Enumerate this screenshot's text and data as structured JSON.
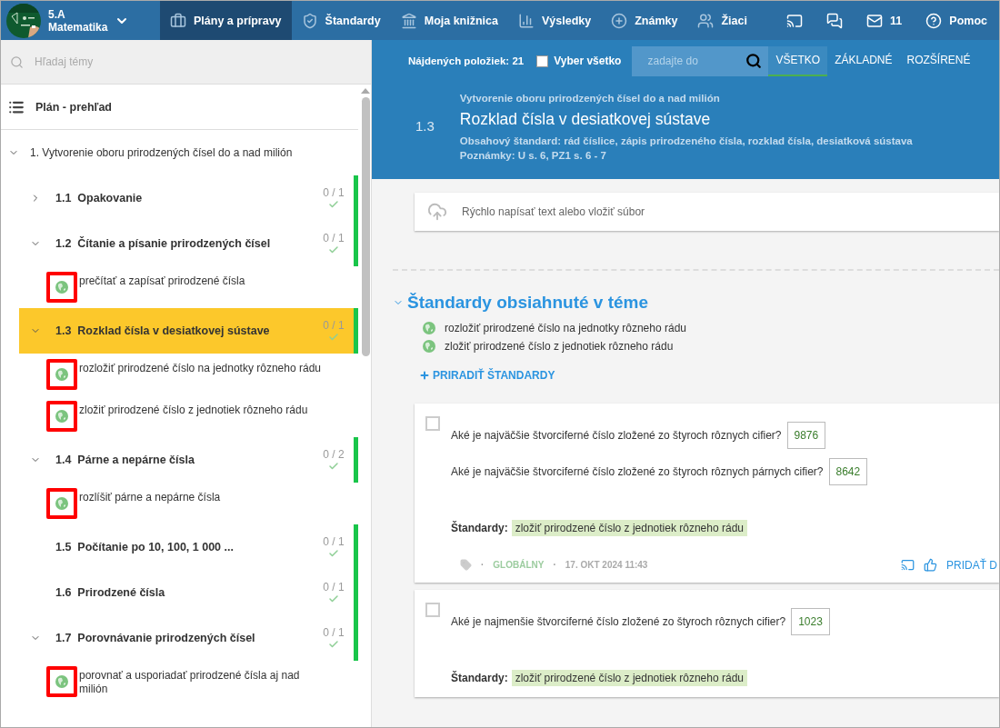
{
  "class_menu": {
    "class": "5.A",
    "subject": "Matematika"
  },
  "nav": [
    {
      "kind": "briefcase",
      "label": "Plány a prípravy",
      "selected": true
    },
    {
      "kind": "shield",
      "label": "Štandardy",
      "selected": false
    },
    {
      "kind": "bank",
      "label": "Moja knižnica",
      "selected": false
    },
    {
      "kind": "chart",
      "label": "Výsledky",
      "selected": false
    },
    {
      "kind": "grade",
      "label": "Známky",
      "selected": false
    },
    {
      "kind": "people",
      "label": "Žiaci",
      "selected": false
    }
  ],
  "toolbar_right": [
    {
      "kind": "cast"
    },
    {
      "kind": "chat"
    },
    {
      "kind": "mail",
      "label": "11"
    },
    {
      "kind": "help",
      "label": "Pomoc"
    }
  ],
  "sidebar": {
    "search": {
      "placeholder": "Hľadaj témy"
    },
    "overview": "Plán - prehľad",
    "sections": [
      {
        "title": "1. Vytvorenie oboru prirodzených čísel do a nad milión",
        "expanded": true,
        "children": [
          {
            "number": "1.1",
            "title": "Opakovanie",
            "count": "0 / 1",
            "expanded": false,
            "selected": false
          },
          {
            "number": "1.2",
            "title": "Čítanie a písanie prirodzených čísel",
            "count": "0 / 1",
            "expanded": true,
            "selected": false,
            "children": [
              {
                "text": "prečítať a zapísať prirodzené čísla",
                "marked": true
              }
            ]
          },
          {
            "number": "1.3",
            "title": "Rozklad čísla v desiatkovej sústave",
            "count": "0 / 1",
            "expanded": true,
            "selected": true,
            "children": [
              {
                "text": "rozložiť prirodzené číslo na jednotky rôzneho rádu",
                "marked": true
              },
              {
                "text": "zložiť prirodzené číslo z jednotiek rôzneho rádu",
                "marked": true
              }
            ]
          },
          {
            "number": "1.4",
            "title": "Párne a nepárne čísla",
            "count": "0 / 2",
            "expanded": true,
            "selected": false,
            "children": [
              {
                "text": "rozlíšiť párne a nepárne čísla",
                "marked": true
              }
            ]
          },
          {
            "number": "1.5",
            "title": "Počítanie po 10, 100, 1 000 ...",
            "count": "0 / 1",
            "selected": false
          },
          {
            "number": "1.6",
            "title": "Prirodzené čísla",
            "count": "0 / 1",
            "selected": false
          },
          {
            "number": "1.7",
            "title": "Porovnávanie prirodzených čísel",
            "count": "0 / 1",
            "expanded": true,
            "selected": false,
            "children": [
              {
                "text": "porovnať a usporiadať prirodzené čísla aj nad milión",
                "marked": true
              }
            ]
          }
        ]
      }
    ]
  },
  "filter_bar": {
    "found": "Nájdených položiek: 21",
    "select_all": {
      "label": "Vyber všetko",
      "checked": false
    },
    "search": {
      "placeholder": "zadajte do"
    },
    "tabs": [
      {
        "label": "VŠETKO",
        "selected": true
      },
      {
        "label": "ZÁKLADNÉ",
        "selected": false
      },
      {
        "label": "ROZŠÍRENÉ",
        "selected": false
      }
    ]
  },
  "topic_header": {
    "breadcrumb": "Vytvorenie oboru prirodzených čísel do a nad milión",
    "number": "1.3",
    "title": "Rozklad čísla v desiatkovej sústave",
    "standard_line": "Obsahový štandard: rád číslice, zápis prirodzeného čísla, rozklad čísla, desiatková sústava",
    "notes": "Poznámky: U s. 6, PZ1 s. 6 - 7"
  },
  "quick_post": {
    "placeholder": "Rýchlo napísať text alebo vložiť súbor"
  },
  "standards_section": {
    "title": "Štandardy obsiahnuté v téme",
    "expanded": true,
    "items": [
      "rozložiť prirodzené číslo na jednotky rôzneho rádu",
      "zložiť prirodzené číslo z jednotiek rôzneho rádu"
    ],
    "add_link": "PRIRADIŤ ŠTANDARDY"
  },
  "cards": [
    {
      "checked": false,
      "questions": [
        {
          "text": "Aké je najväčšie štvorciferné číslo zložené zo štyroch rôznych cifier?",
          "answer": "9876"
        },
        {
          "text": "Aké je najväčšie štvorciferné číslo zložené zo štyroch rôznych párnych cifier?",
          "answer": "8642"
        }
      ],
      "standards_label": "Štandardy:",
      "standards": [
        "zložiť prirodzené číslo z jednotiek rôzneho rádu"
      ],
      "footer": {
        "separator": "·",
        "scope": "GLOBÁLNY",
        "date": "17. OKT 2024 11:43",
        "action": "PRIDAŤ D"
      }
    },
    {
      "checked": false,
      "questions": [
        {
          "text": "Aké je najmenšie štvorciferné číslo zložené zo štyroch rôznych cifier?",
          "answer": "1023"
        }
      ],
      "standards_label": "Štandardy:",
      "standards": [
        "zložiť prirodzené číslo z jednotiek rôzneho rádu"
      ]
    }
  ]
}
